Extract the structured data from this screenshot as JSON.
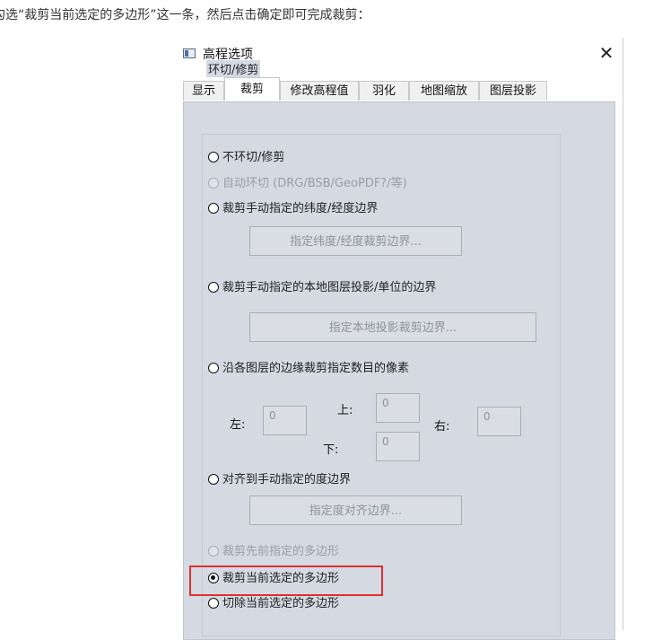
{
  "caption": "勾选“裁剪当前选定的多边形”这一条，然后点击确定即可完成裁剪：",
  "window": {
    "title": "高程选项",
    "close_symbol": "✕"
  },
  "tabs": [
    "显示",
    "裁剪",
    "修改高程值",
    "羽化",
    "地图缩放",
    "图层投影"
  ],
  "active_tab": "裁剪",
  "group": {
    "title": "环切/修剪"
  },
  "options": {
    "no_clip": "不环切/修剪",
    "auto_clip": "自动环切 (DRG/BSB/GeoPDF?/等)",
    "latlon_bounds": "裁剪手动指定的纬度/经度边界",
    "local_bounds": "裁剪手动指定的本地图层投影/单位的边界",
    "edge_pixels": "沿各图层的边缘裁剪指定数目的像素",
    "snap_degree": "对齐到手动指定的度边界",
    "prev_polygon": "裁剪先前指定的多边形",
    "current_polygon": "裁剪当前选定的多边形",
    "cut_polygon": "切除当前选定的多边形"
  },
  "buttons": {
    "latlon": "指定纬度/经度裁剪边界...",
    "local": "指定本地投影裁剪边界...",
    "snap": "指定度对齐边界..."
  },
  "pixels": {
    "left_label": "左:",
    "left_value": "0",
    "top_label": "上:",
    "top_value": "0",
    "right_label": "右:",
    "right_value": "0",
    "bottom_label": "下:",
    "bottom_value": "0"
  },
  "colors": {
    "highlight": "#e03030",
    "panel": "#d4d9e2"
  }
}
